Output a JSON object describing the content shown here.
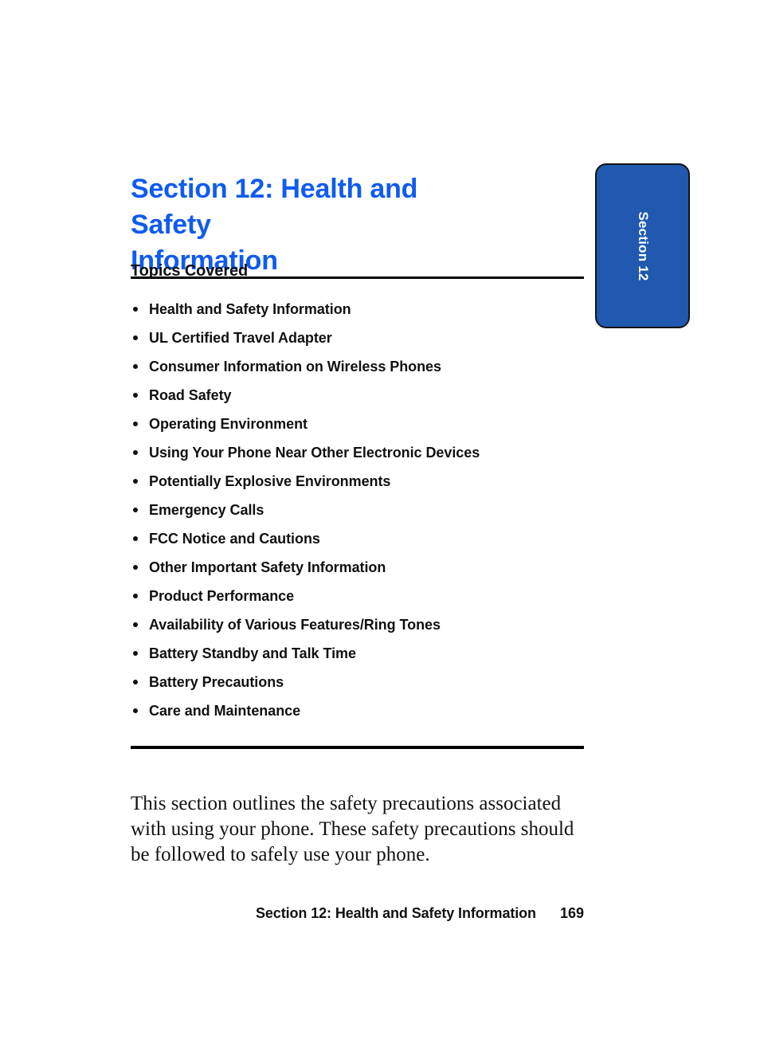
{
  "document": {
    "title_line_1": "Section 12: Health and Safety",
    "title_line_2": "Information",
    "title_color": "#0F5BEE",
    "topics_heading": "Topics Covered",
    "topics": [
      "Health and Safety Information",
      "UL Certified Travel Adapter",
      "Consumer Information on Wireless Phones",
      "Road Safety",
      "Operating Environment",
      "Using Your Phone Near Other Electronic Devices",
      "Potentially Explosive Environments",
      "Emergency Calls",
      "FCC Notice and Cautions",
      "Other Important Safety Information",
      "Product Performance",
      "Availability of Various Features/Ring Tones",
      "Battery Standby and Talk Time",
      "Battery Precautions",
      "Care and Maintenance"
    ],
    "body_paragraph": "This section outlines the safety precautions associated with using your phone. These safety precautions should be followed to safely use your phone."
  },
  "side_tab": {
    "label": "Section 12",
    "fill_color": "#2059AF",
    "border_color": "#131313",
    "text_color": "#FFFFFF"
  },
  "footer": {
    "title": "Section 12: Health and Safety Information",
    "page_number": "169"
  }
}
